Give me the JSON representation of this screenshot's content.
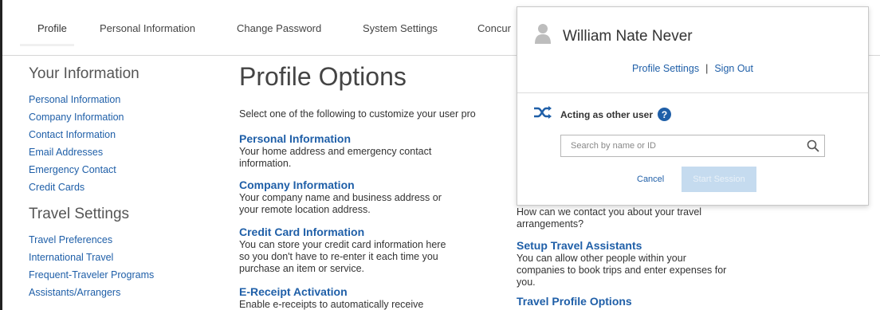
{
  "topnav": {
    "tabs": [
      "Profile",
      "Personal Information",
      "Change Password",
      "System Settings",
      "Concur"
    ]
  },
  "sidebar": {
    "your_info_heading": "Your Information",
    "your_info_items": [
      "Personal Information",
      "Company Information",
      "Contact Information",
      "Email Addresses",
      "Emergency Contact",
      "Credit Cards"
    ],
    "travel_heading": "Travel Settings",
    "travel_items": [
      "Travel Preferences",
      "International Travel",
      "Frequent-Traveler Programs",
      "Assistants/Arrangers"
    ]
  },
  "main": {
    "title": "Profile Options",
    "intro": "Select one of the following to customize your user pro",
    "options": [
      {
        "title": "Personal Information",
        "desc": [
          "Your home address and emergency contact",
          "information."
        ]
      },
      {
        "title": "Company Information",
        "desc": [
          "Your company name and business address or",
          "your remote location address."
        ]
      },
      {
        "title": "Credit Card Information",
        "desc": [
          "You can store your credit card information here",
          "so you don't have to re-enter it each time you",
          "purchase an item or service."
        ]
      },
      {
        "title": "E-Receipt Activation",
        "desc": [
          "Enable e-receipts to automatically receive"
        ]
      }
    ],
    "right_options": {
      "contact_desc": [
        "How can we contact you about your travel",
        "arrangements?"
      ],
      "assistants_title": "Setup Travel Assistants",
      "assistants_desc": [
        "You can allow other people within your",
        "companies to book trips and enter expenses for",
        "you."
      ],
      "profile_options_title": "Travel Profile Options"
    }
  },
  "popup": {
    "user_name": "William Nate Never",
    "profile_settings": "Profile Settings",
    "separator": "|",
    "sign_out": "Sign Out",
    "acting_label": "Acting as other user",
    "help_glyph": "?",
    "search_placeholder": "Search by name or ID",
    "cancel": "Cancel",
    "start_session": "Start Session"
  },
  "colors": {
    "link": "#1f5fa8",
    "start_button_disabled": "#c5dbef"
  },
  "icons": [
    "user-avatar-icon",
    "shuffle-icon",
    "help-icon",
    "search-icon"
  ]
}
